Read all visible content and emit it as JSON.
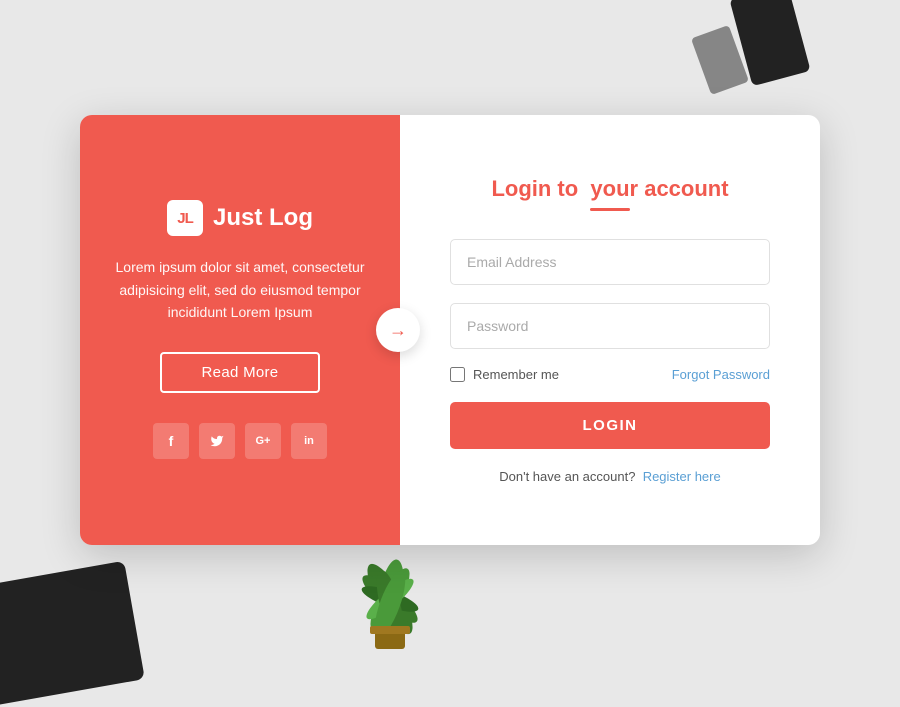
{
  "background": {
    "color": "#e8e8e8"
  },
  "card": {
    "left_panel": {
      "logo_icon_text": "JL",
      "logo_label": "Just Log",
      "description": "Lorem ipsum dolor sit amet, consectetur adipisicing elit, sed do eiusmod tempor incididunt Lorem Ipsum",
      "read_more_label": "Read More",
      "social": [
        {
          "label": "f",
          "name": "facebook"
        },
        {
          "label": "t",
          "name": "twitter"
        },
        {
          "label": "G+",
          "name": "google-plus"
        },
        {
          "label": "in",
          "name": "linkedin"
        }
      ],
      "arrow_label": "→"
    },
    "right_panel": {
      "title_plain": "Login to",
      "title_accent": "your account",
      "email_placeholder": "Email Address",
      "password_placeholder": "Password",
      "remember_me_label": "Remember me",
      "forgot_password_label": "Forgot Password",
      "login_button_label": "LOGIN",
      "no_account_text": "Don't have an account?",
      "register_link_label": "Register here"
    }
  }
}
